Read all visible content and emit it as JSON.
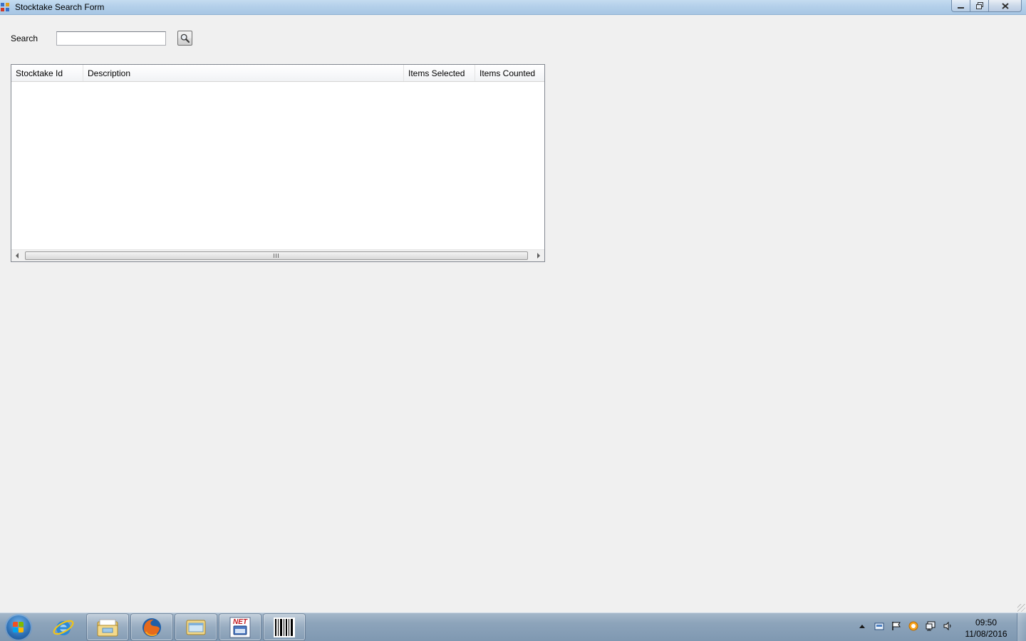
{
  "window": {
    "title": "Stocktake Search Form",
    "caption": {
      "minimize": "minimize-icon",
      "maximize": "restore-icon",
      "close": "close-icon"
    }
  },
  "search": {
    "label": "Search",
    "value": "",
    "placeholder": "",
    "button_icon": "magnifier-icon"
  },
  "grid": {
    "columns": [
      "Stocktake Id",
      "Description",
      "Items Selected",
      "Items Counted"
    ],
    "rows": []
  },
  "taskbar": {
    "apps": [
      {
        "name": "internet-explorer",
        "icon": "ie-icon"
      },
      {
        "name": "file-explorer",
        "icon": "folder-icon"
      },
      {
        "name": "firefox",
        "icon": "firefox-icon"
      },
      {
        "name": "folder-window",
        "icon": "folder-window-icon"
      },
      {
        "name": "dotnet-app",
        "icon": "net-app-icon",
        "label": "NET"
      },
      {
        "name": "barcode-app",
        "icon": "barcode-icon"
      }
    ],
    "tray_icons": [
      "show-hidden-icon",
      "message-icon",
      "action-center-flag-icon",
      "update-icon",
      "network-icon",
      "volume-icon"
    ],
    "clock": {
      "time": "09:50",
      "date": "11/08/2016"
    }
  },
  "colors": {
    "form_background": "#f0f0f0",
    "titlebar": "#b4d0ea",
    "taskbar": "#8da4bb"
  }
}
